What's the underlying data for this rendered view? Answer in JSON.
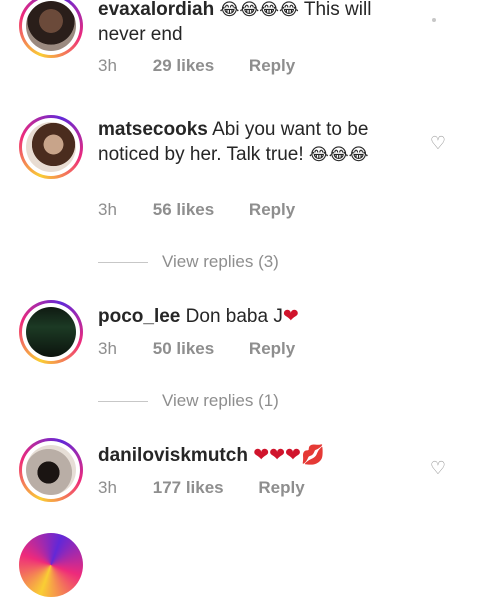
{
  "comments": [
    {
      "username": "evaxalordiah",
      "emojis": "😂😂😂😂",
      "text": " This will never end",
      "time": "3h",
      "likes": "29 likes",
      "reply": "Reply"
    },
    {
      "username": "matsecooks",
      "text": " Abi you want to be noticed by her. Talk true! ",
      "emojis": "😂😂😂",
      "time": "3h",
      "likes": "56 likes",
      "reply": "Reply",
      "view_replies": "View replies (3)"
    },
    {
      "username": "poco_lee",
      "text": " Don baba J",
      "emojis": "❤",
      "time": "3h",
      "likes": "50 likes",
      "reply": "Reply",
      "view_replies": "View replies (1)"
    },
    {
      "username": "daniloviskmutch",
      "emojis": "❤❤❤💋",
      "time": "3h",
      "likes": "177 likes",
      "reply": "Reply"
    }
  ],
  "icons": {
    "like": "heart-outline-icon"
  }
}
